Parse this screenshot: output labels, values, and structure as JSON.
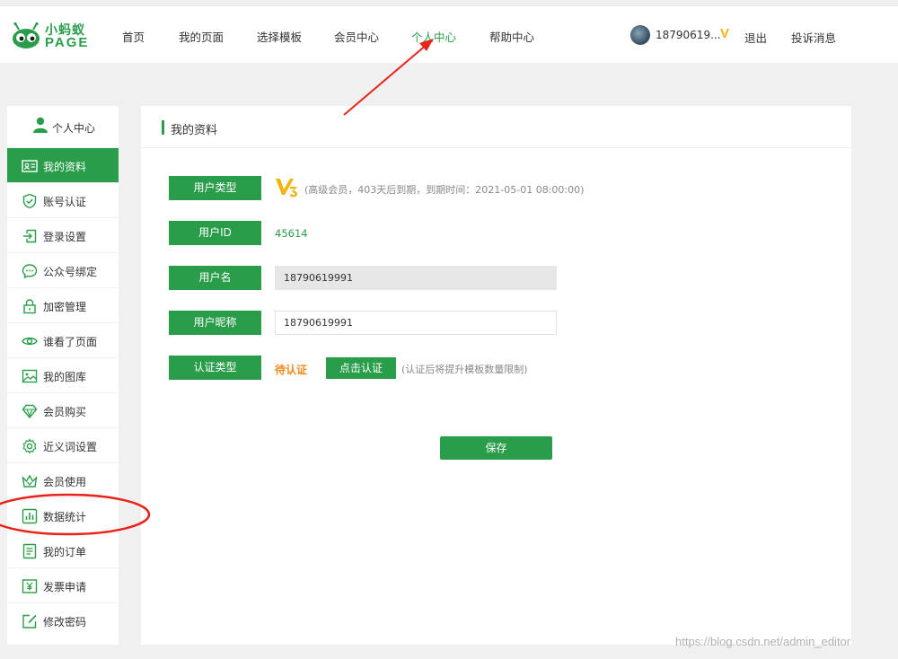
{
  "logo": {
    "cn": "小蚂蚁",
    "en": "PAGE"
  },
  "nav": [
    "首页",
    "我的页面",
    "选择模板",
    "会员中心",
    "个人中心",
    "帮助中心"
  ],
  "user": {
    "name": "18790619...",
    "vip": "V",
    "logout": "退出",
    "complaint": "投诉消息"
  },
  "sidebar": {
    "title": "个人中心",
    "items": [
      {
        "label": "我的资料",
        "icon": "profile-card-icon"
      },
      {
        "label": "账号认证",
        "icon": "shield-check-icon"
      },
      {
        "label": "登录设置",
        "icon": "login-icon"
      },
      {
        "label": "公众号绑定",
        "icon": "chat-bubble-icon"
      },
      {
        "label": "加密管理",
        "icon": "lock-icon"
      },
      {
        "label": "谁看了页面",
        "icon": "eye-icon"
      },
      {
        "label": "我的图库",
        "icon": "image-icon"
      },
      {
        "label": "会员购买",
        "icon": "diamond-icon"
      },
      {
        "label": "近义词设置",
        "icon": "gear-icon"
      },
      {
        "label": "会员使用",
        "icon": "crown-icon"
      },
      {
        "label": "数据统计",
        "icon": "bar-chart-icon"
      },
      {
        "label": "我的订单",
        "icon": "order-list-icon"
      },
      {
        "label": "发票申请",
        "icon": "invoice-icon"
      },
      {
        "label": "修改密码",
        "icon": "edit-icon"
      }
    ]
  },
  "panel": {
    "title": "我的资料",
    "user_type_label": "用户类型",
    "vip_note": "(高级会员，403天后到期，到期时间：2021-05-01 08:00:00)",
    "user_id_label": "用户ID",
    "user_id": "45614",
    "username_label": "用户名",
    "username": "18790619991",
    "nickname_label": "用户昵称",
    "nickname": "18790619991",
    "verify_type_label": "认证类型",
    "verify_status": "待认证",
    "verify_button": "点击认证",
    "verify_note": "(认证后将提升模板数量限制)",
    "save_button": "保存"
  },
  "colors": {
    "brand": "#2a9d4a",
    "pending": "#f08a1c",
    "vip": "#f2b40c",
    "annotation": "#e8231a"
  },
  "watermark": "https://blog.csdn.net/admin_editor"
}
